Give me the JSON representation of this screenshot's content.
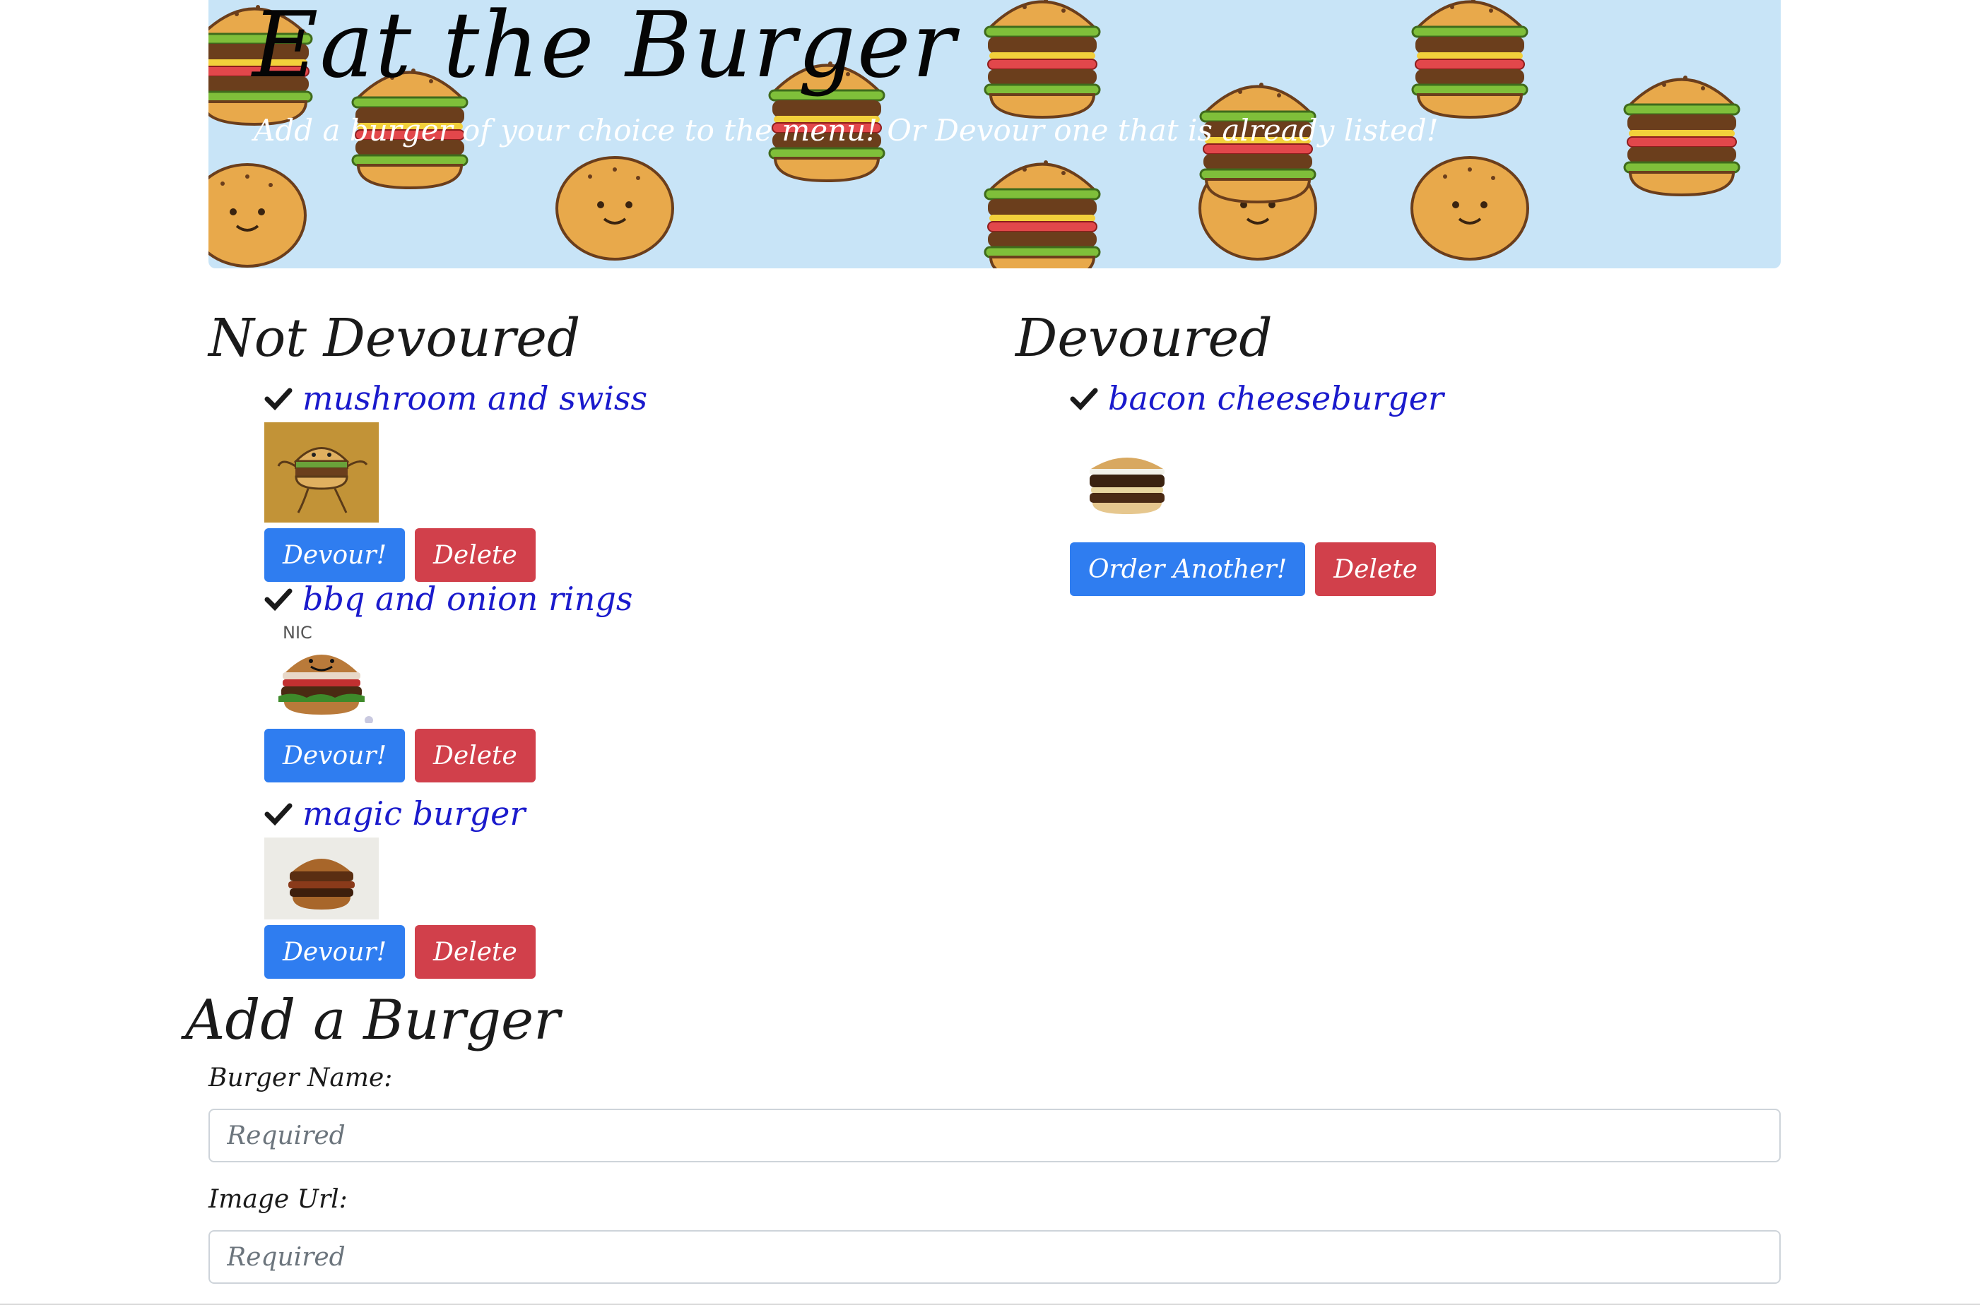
{
  "header": {
    "title": "Eat the Burger",
    "subtitle": "Add a burger of your choice to the menu! Or Devour one that is already listed!"
  },
  "not_devoured": {
    "heading": "Not Devoured",
    "items": [
      {
        "name": "mushroom and swiss",
        "image_icon": "dancing-burger-cartoon",
        "devour_label": "Devour!",
        "delete_label": "Delete"
      },
      {
        "name": "bbq and onion rings",
        "image_icon": "smiling-burger-photo",
        "image_caption": "NIC",
        "devour_label": "Devour!",
        "delete_label": "Delete"
      },
      {
        "name": "magic burger",
        "image_icon": "bacon-burger-photo",
        "devour_label": "Devour!",
        "delete_label": "Delete"
      }
    ]
  },
  "devoured": {
    "heading": "Devoured",
    "items": [
      {
        "name": "bacon cheeseburger",
        "image_icon": "cheeseburger-photo",
        "order_label": "Order Another!",
        "delete_label": "Delete"
      }
    ]
  },
  "add_form": {
    "heading": "Add a Burger",
    "name_label": "Burger Name:",
    "name_placeholder": "Required",
    "url_label": "Image Url:",
    "url_placeholder": "Required"
  },
  "colors": {
    "banner": "#c8e4f7",
    "link": "#1a1acc",
    "primary_button": "#2f7df0",
    "danger_button": "#d1404b"
  }
}
